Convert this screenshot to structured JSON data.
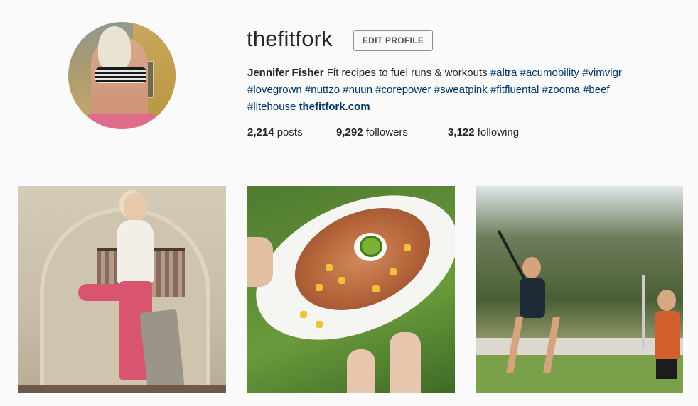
{
  "profile": {
    "username": "thefitfork",
    "edit_button_label": "EDIT PROFILE",
    "bio": {
      "full_name": "Jennifer Fisher",
      "text": " Fit recipes to fuel runs & workouts ",
      "hashtags": [
        "#altra",
        "#acumobility",
        "#vimvigr",
        "#lovegrown",
        "#nuttzo",
        "#nuun",
        "#corepower",
        "#sweatpink",
        "#fitfluental",
        "#zooma",
        "#beef",
        "#litehouse"
      ],
      "website": "thefitfork.com"
    },
    "stats": {
      "posts_count": "2,214",
      "posts_label": "posts",
      "followers_count": "9,292",
      "followers_label": "followers",
      "following_count": "3,122",
      "following_label": "following"
    }
  },
  "colors": {
    "background": "#fafafa",
    "text": "#262626",
    "link": "#003569"
  },
  "posts": [
    {
      "subject": "yoga-tree-pose-photo"
    },
    {
      "subject": "stuffed-sweet-potato-photo"
    },
    {
      "subject": "lacrosse-outdoor-photo"
    }
  ]
}
